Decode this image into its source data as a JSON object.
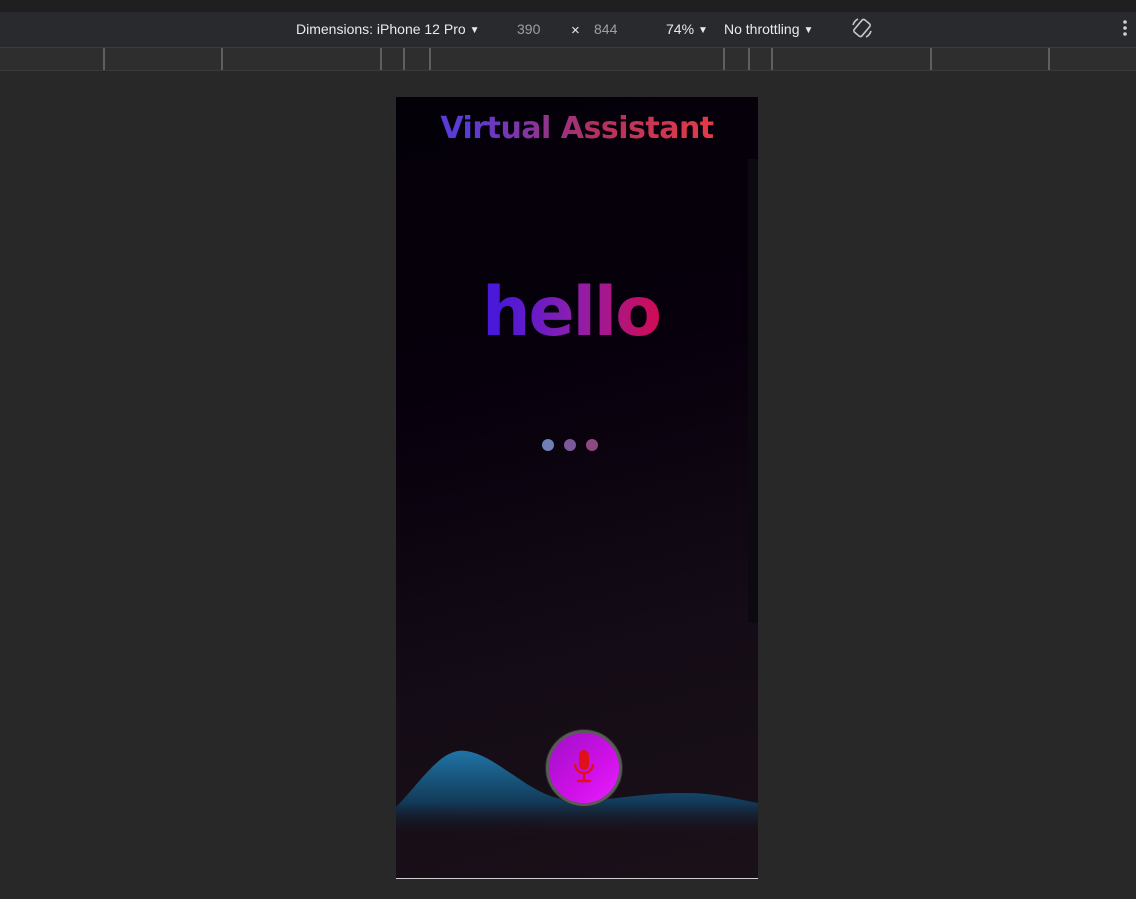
{
  "devtools": {
    "dimensions_label": "Dimensions: iPhone 12 Pro",
    "width_value": "390",
    "height_value": "844",
    "times_symbol": "×",
    "zoom": "74%",
    "throttling": "No throttling",
    "icons": [
      "caret-down-icon",
      "rotate-icon",
      "more-vert-icon"
    ]
  },
  "app": {
    "title": "Virtual Assistant",
    "speech_text": "hello",
    "mic_icon": "microphone-icon",
    "colors": {
      "title_gradient": [
        "#5a3bd6",
        "#e03a4a"
      ],
      "speech_gradient": [
        "#4a18d8",
        "#d00c55"
      ],
      "mic_button": "#d010e8",
      "mic_icon": "#e0101a",
      "wave": "#1e6b9a",
      "dots": [
        "#6f7fb8",
        "#7a5a9a",
        "#8e4a80"
      ]
    }
  }
}
